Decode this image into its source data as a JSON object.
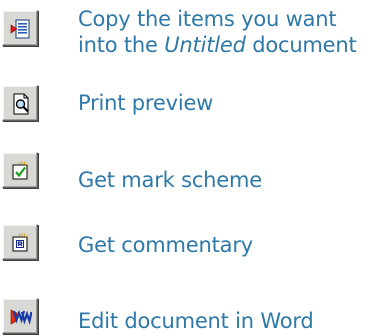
{
  "items": [
    {
      "icon": "copy-to-document-icon",
      "line1": "Copy the items you want",
      "line2_prefix": "into the ",
      "line2_italic": "Untitled",
      "line2_suffix": " document"
    },
    {
      "icon": "print-preview-icon",
      "label": "Print preview"
    },
    {
      "icon": "mark-scheme-icon",
      "label": "Get mark scheme"
    },
    {
      "icon": "commentary-icon",
      "label": "Get commentary"
    },
    {
      "icon": "word-document-icon",
      "label": "Edit document in Word"
    }
  ],
  "colors": {
    "text": "#2e79a8",
    "button_face": "#d8d8d4"
  }
}
